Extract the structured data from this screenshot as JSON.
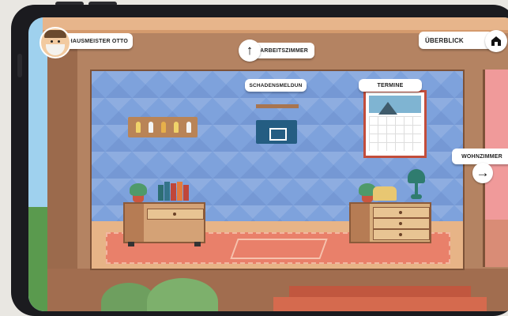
{
  "hud": {
    "character_name": "HAUSMEISTER OTTO",
    "overview_label": "ÜBERBLICK",
    "home_icon": "home-icon"
  },
  "navigation": {
    "up_room": "ARBEITSZIMMER",
    "up_arrow": "↑",
    "right_room": "WOHNZIMMER",
    "right_arrow": "→"
  },
  "room_items": {
    "damage_report_label": "SCHADENSMELDUN",
    "appointments_label": "TERMINE"
  },
  "colors": {
    "wall": "#7ea2dc",
    "floor": "#e7b487",
    "rug": "#e9806a",
    "house": "#b48362",
    "mailbox": "#245d82",
    "calendar_frame": "#c24d3b"
  }
}
